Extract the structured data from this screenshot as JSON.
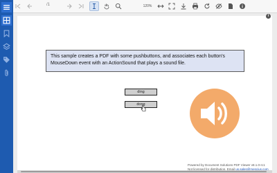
{
  "toolbar": {
    "zoom_value": "120%",
    "page_nav_text": "/1"
  },
  "sidebar": {
    "items": [
      {
        "icon": "menu-icon"
      },
      {
        "icon": "thumbnails-icon"
      },
      {
        "icon": "bookmark-icon"
      },
      {
        "icon": "layers-icon"
      },
      {
        "icon": "tag-icon"
      },
      {
        "icon": "attachment-icon"
      }
    ]
  },
  "document": {
    "notice_text": "This sample creates a PDF with some pushbuttons, and associates each button's MouseDown event with an ActionSound that plays a sound file.",
    "buttons": [
      "ding",
      "dong"
    ],
    "footer_line1": "Powered by Document Solutions PDF Viewer v8.1.0-rc1",
    "footer_line2_prefix": "Not licensed for distribution. Email ",
    "footer_email": "us.sales@mescius.com"
  },
  "colors": {
    "sidebar": "#1e5bb0",
    "notice_bg": "#dde3f3",
    "speaker": "#f3a35e"
  }
}
